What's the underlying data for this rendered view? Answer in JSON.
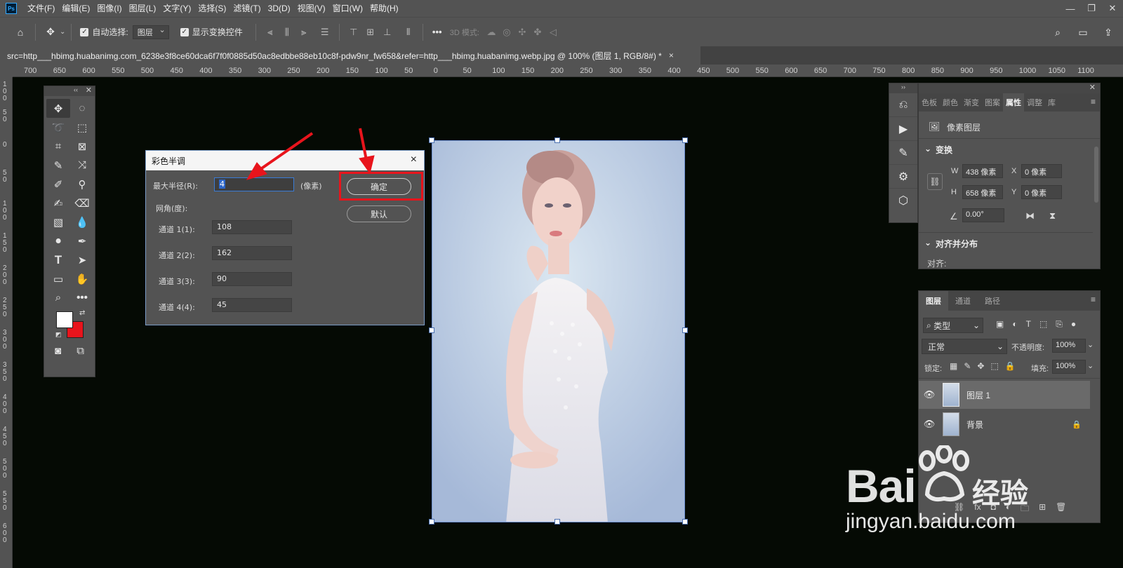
{
  "menubar": {
    "app_icon": "Ps",
    "items": [
      "文件(F)",
      "编辑(E)",
      "图像(I)",
      "图层(L)",
      "文字(Y)",
      "选择(S)",
      "滤镜(T)",
      "3D(D)",
      "视图(V)",
      "窗口(W)",
      "帮助(H)"
    ]
  },
  "options": {
    "auto_select_label": "自动选择:",
    "auto_select_value": "图层",
    "show_transform_label": "显示变换控件",
    "mode_3d_label": "3D 模式:"
  },
  "document": {
    "tab_title": "src=http___hbimg.huabanimg.com_6238e3f8ce60dca6f7f0f0885d50ac8edbbe88eb10c8f-pdw9nr_fw658&refer=http___hbimg.huabanimg.webp.jpg @ 100% (图层 1, RGB/8#) *",
    "tab_close": "×"
  },
  "ruler_top": [
    "700",
    "650",
    "600",
    "550",
    "500",
    "450",
    "400",
    "350",
    "300",
    "250",
    "200",
    "150",
    "100",
    "50",
    "0",
    "50",
    "100",
    "150",
    "200",
    "250",
    "300",
    "350",
    "400",
    "450",
    "500",
    "550",
    "600",
    "650",
    "700",
    "750",
    "800",
    "850",
    "900",
    "950",
    "1000",
    "1050",
    "1100"
  ],
  "dialog": {
    "title": "彩色半调",
    "max_radius_label": "最大半径(R):",
    "max_radius_value": "4",
    "unit": "(像素)",
    "screen_angle_label": "网角(度):",
    "channels": [
      {
        "label": "通道 1(1):",
        "value": "108"
      },
      {
        "label": "通道 2(2):",
        "value": "162"
      },
      {
        "label": "通道 3(3):",
        "value": "90"
      },
      {
        "label": "通道 4(4):",
        "value": "45"
      }
    ],
    "ok_label": "确定",
    "default_label": "默认",
    "close": "×"
  },
  "properties": {
    "tabs": [
      "色板",
      "颜色",
      "渐变",
      "图案",
      "属性",
      "调整",
      "库"
    ],
    "active_tab": "属性",
    "type_label": "像素图层",
    "transform_title": "变换",
    "w_label": "W",
    "w_value": "438 像素",
    "h_label": "H",
    "h_value": "658 像素",
    "x_label": "X",
    "x_value": "0 像素",
    "y_label": "Y",
    "y_value": "0 像素",
    "angle_value": "0.00°",
    "align_title": "对齐并分布",
    "align_label": "对齐:"
  },
  "layers": {
    "tabs": [
      "图层",
      "通道",
      "路径"
    ],
    "filter_label": "类型",
    "blend_mode": "正常",
    "opacity_label": "不透明度:",
    "opacity_value": "100%",
    "lock_label": "锁定:",
    "fill_label": "填充:",
    "fill_value": "100%",
    "items": [
      {
        "name": "图层 1"
      },
      {
        "name": "背景"
      }
    ]
  },
  "watermark": {
    "brand": "Bai",
    "product": "经验",
    "url": "jingyan.baidu.com"
  },
  "colors": {
    "foreground": "#ffffff",
    "background": "#e8141c",
    "annotation_red": "#e8141c"
  }
}
